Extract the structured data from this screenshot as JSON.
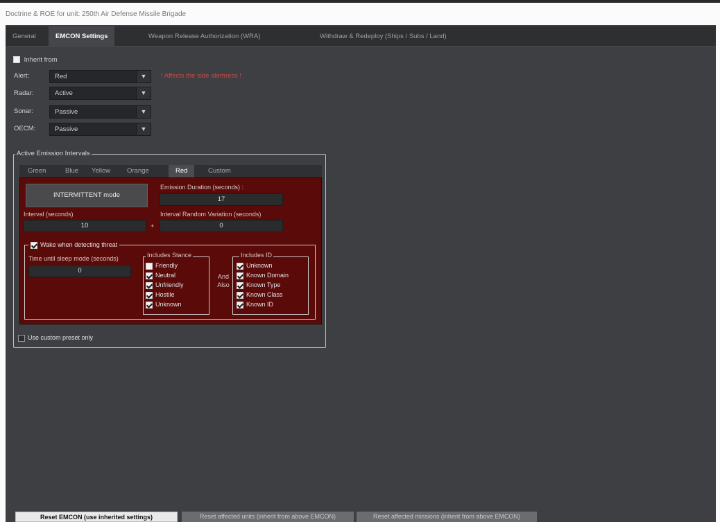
{
  "window": {
    "title": "Doctrine & ROE for unit: 250th Air Defense Missile Brigade"
  },
  "tabs": [
    {
      "label": "General"
    },
    {
      "label": "EMCON Settings"
    },
    {
      "label": "Weapon Release Authorization (WRA)"
    },
    {
      "label": "Withdraw & Redeploy (Ships / Subs / Land)"
    }
  ],
  "inherit": {
    "label": "Inherit from"
  },
  "fields": {
    "alert": {
      "label": "Alert:",
      "value": "Red",
      "note": "! Affects the side alertness !"
    },
    "radar": {
      "label": "Radar:",
      "value": "Active"
    },
    "sonar": {
      "label": "Sonar:",
      "value": "Passive"
    },
    "oecm": {
      "label": "OECM:",
      "value": "Passive"
    }
  },
  "emission": {
    "title": "Active Emission Intervals",
    "tabs": [
      "Green",
      "Blue",
      "Yellow",
      "Orange",
      "Red",
      "Custom"
    ],
    "active_tab": "Red",
    "mode_button": "INTERMITTENT mode",
    "duration_label": "Emission Duration (seconds) :",
    "duration_value": "17",
    "interval_label": "Interval (seconds)",
    "interval_value": "10",
    "separator": "+",
    "variation_label": "Interval Random Variation (seconds)",
    "variation_value": "0",
    "wake": {
      "label": "Wake when detecting threat",
      "checked": true,
      "sleep_label": "Time until sleep mode (seconds)",
      "sleep_value": "0",
      "stance_title": "Includes Stance",
      "stance": [
        {
          "label": "Friendly",
          "checked": false
        },
        {
          "label": "Neutral",
          "checked": true
        },
        {
          "label": "Unfriendly",
          "checked": true
        },
        {
          "label": "Hostile",
          "checked": true
        },
        {
          "label": "Unknown",
          "checked": true
        }
      ],
      "and_also": "And Also",
      "id_title": "Includes ID",
      "ids": [
        {
          "label": "Unknown",
          "checked": true
        },
        {
          "label": "Known Domain",
          "checked": true
        },
        {
          "label": "Known Type",
          "checked": true
        },
        {
          "label": "Known Class",
          "checked": true
        },
        {
          "label": "Known ID",
          "checked": true
        }
      ]
    },
    "custom_preset": "Use custom preset only"
  },
  "bottom_buttons": [
    "Reset EMCON (use inherited settings)",
    "Reset affected units (inherit from above EMCON)",
    "Reset affected missions (inherit from above EMCON)"
  ],
  "colors": {
    "red_panel": "#5a0a08",
    "alert_note": "#d64545"
  }
}
